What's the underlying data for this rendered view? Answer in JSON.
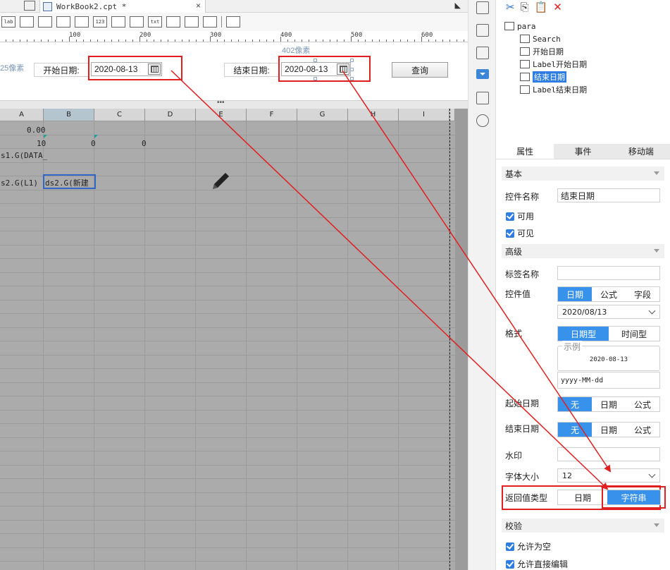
{
  "editor": {
    "tab_title": "WorkBook2.cpt *",
    "tab_close": "×",
    "collapse_glyph": "◣",
    "toolbar_labels": [
      "lab",
      "",
      "",
      "",
      "",
      "123",
      "",
      "",
      "txt",
      "",
      "",
      ""
    ],
    "ruler_numbers": [
      "100",
      "200",
      "300",
      "400",
      "500",
      "600"
    ],
    "px_left": "25像素",
    "px_right": "402像素",
    "start_label": "开始日期:",
    "start_value": "2020-08-13",
    "end_label": "结束日期:",
    "end_value": "2020-08-13",
    "query_button": "查询",
    "splitter_dots": "•••",
    "columns": [
      "A",
      "B",
      "C",
      "D",
      "E",
      "F",
      "G",
      "H",
      "I"
    ],
    "selected_column": "B",
    "cells": {
      "a1": "0.00",
      "a2": "10",
      "b2": "0",
      "c2": "0",
      "a3": "s1.G(DATA_",
      "a5": "s2.G(L1)",
      "b5": "ds2.G(新建"
    },
    "pencil_icon_name": "pencil-icon"
  },
  "rpanel": {
    "tools": [
      "✂",
      "⎘",
      "📋",
      "✕"
    ],
    "tree": [
      {
        "label": "para",
        "icon": "form-icon",
        "level": 0
      },
      {
        "label": "Search",
        "icon": "search-doc-icon",
        "level": 1
      },
      {
        "label": "开始日期",
        "icon": "calendar-icon",
        "level": 1
      },
      {
        "label": "Label开始日期",
        "icon": "label-icon",
        "level": 1
      },
      {
        "label": "结束日期",
        "icon": "calendar-icon",
        "level": 1,
        "selected": true
      },
      {
        "label": "Label结束日期",
        "icon": "label-icon",
        "level": 1
      }
    ],
    "tabs": [
      "属性",
      "事件",
      "移动端"
    ],
    "active_tab": "属性",
    "sections": {
      "basic": "基本",
      "advanced": "高级",
      "validate": "校验"
    },
    "props": {
      "control_name_label": "控件名称",
      "control_name_value": "结束日期",
      "enabled_label": "可用",
      "visible_label": "可见",
      "tag_name_label": "标签名称",
      "tag_name_value": "",
      "control_value_label": "控件值",
      "control_value_opts": [
        "日期",
        "公式",
        "字段"
      ],
      "control_value_selected": "日期",
      "date_value": "2020/08/13",
      "format_label": "格式",
      "format_opts": [
        "日期型",
        "时间型"
      ],
      "format_selected": "日期型",
      "example_legend": "示例",
      "example_value": "2020-08-13",
      "format_pattern": "yyyy-MM-dd",
      "start_date_label": "起始日期",
      "end_date_label": "结束日期",
      "range_opts": [
        "无",
        "日期",
        "公式"
      ],
      "range_selected": "无",
      "watermark_label": "水印",
      "watermark_value": "",
      "font_size_label": "字体大小",
      "font_size_value": "12",
      "return_type_label": "返回值类型",
      "return_type_opts": [
        "日期",
        "字符串"
      ],
      "return_type_selected": "字符串",
      "allow_empty_label": "允许为空",
      "allow_edit_label": "允许直接编辑"
    }
  },
  "colors": {
    "annotation_red": "#e02020",
    "accent_blue": "#3891ea",
    "sheet_gray": "#ababab"
  }
}
